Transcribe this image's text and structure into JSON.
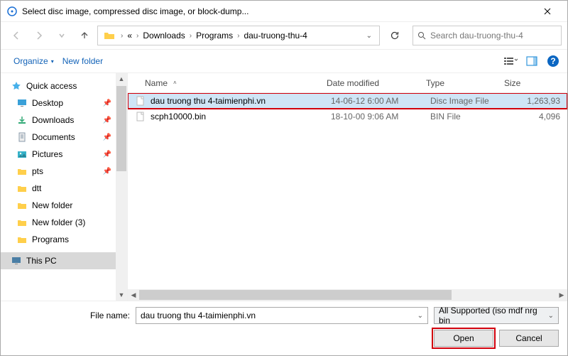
{
  "title": "Select disc image, compressed disc image, or block-dump...",
  "breadcrumb": {
    "parts": [
      "Downloads",
      "Programs",
      "dau-truong-thu-4"
    ]
  },
  "search": {
    "placeholder": "Search dau-truong-thu-4"
  },
  "toolbar": {
    "organize": "Organize",
    "newfolder": "New folder"
  },
  "sidebar": {
    "quick": "Quick access",
    "items": [
      {
        "label": "Desktop",
        "pinned": true
      },
      {
        "label": "Downloads",
        "pinned": true
      },
      {
        "label": "Documents",
        "pinned": true
      },
      {
        "label": "Pictures",
        "pinned": true
      },
      {
        "label": "pts",
        "pinned": true
      },
      {
        "label": "dtt",
        "pinned": false
      },
      {
        "label": "New folder",
        "pinned": false
      },
      {
        "label": "New folder (3)",
        "pinned": false
      },
      {
        "label": "Programs",
        "pinned": false
      }
    ],
    "thispc": "This PC"
  },
  "columns": {
    "name": "Name",
    "date": "Date modified",
    "type": "Type",
    "size": "Size"
  },
  "files": [
    {
      "name": "dau truong thu 4-taimienphi.vn",
      "date": "14-06-12 6:00 AM",
      "type": "Disc Image File",
      "size": "1,263,93",
      "selected": true
    },
    {
      "name": "scph10000.bin",
      "date": "18-10-00 9:06 AM",
      "type": "BIN File",
      "size": "4,096",
      "selected": false
    }
  ],
  "footer": {
    "filename_label": "File name:",
    "filename_value": "dau truong thu 4-taimienphi.vn",
    "filter": "All Supported (iso mdf nrg bin",
    "open": "Open",
    "cancel": "Cancel"
  }
}
